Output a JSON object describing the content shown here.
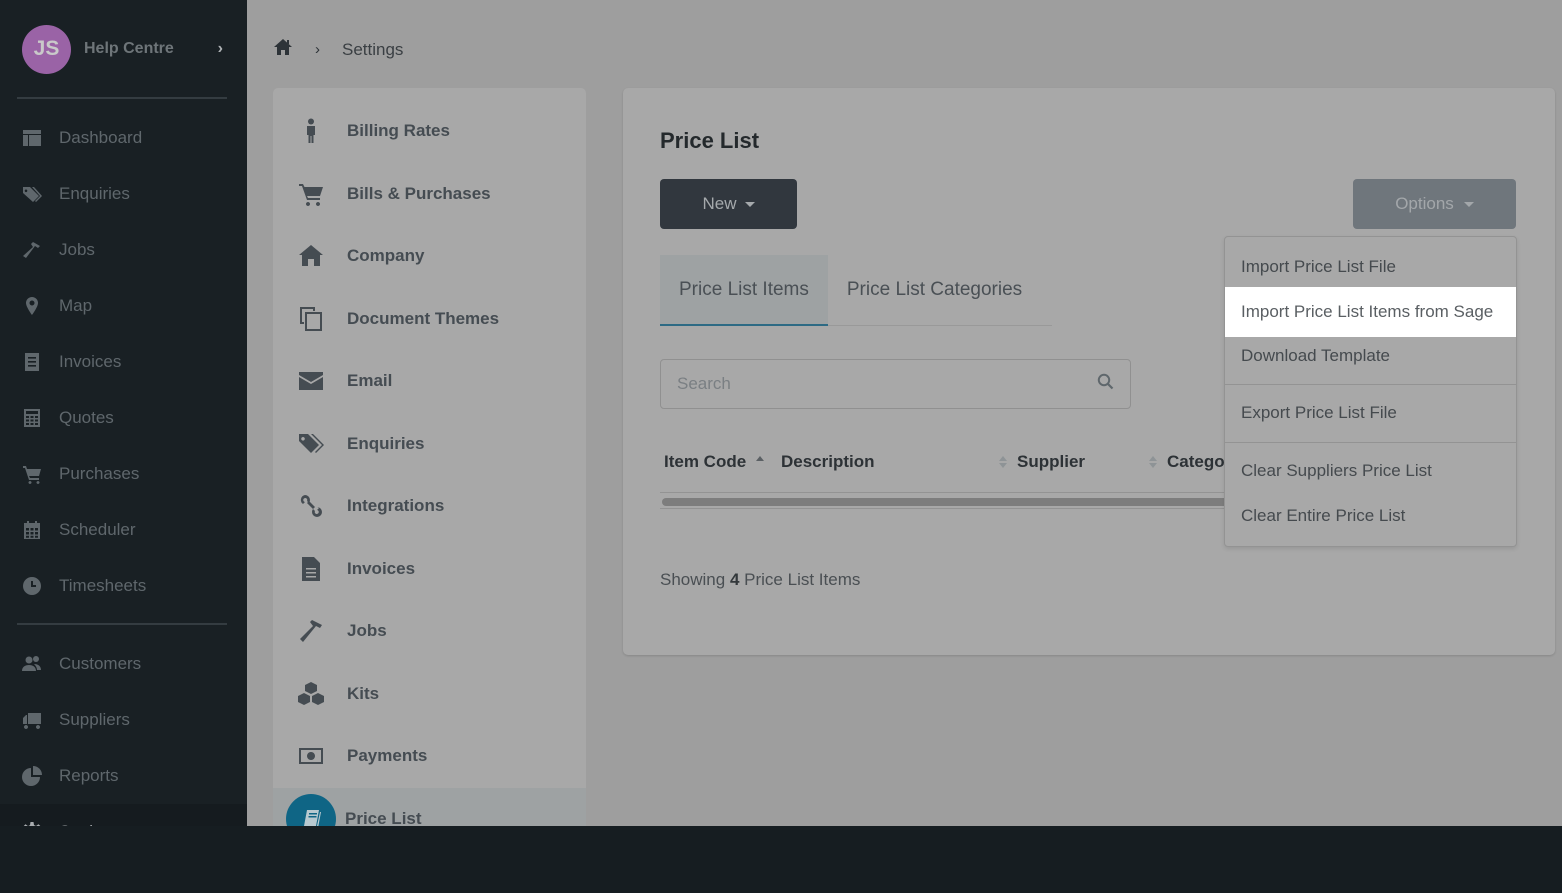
{
  "sidebar": {
    "avatar_initials": "JS",
    "title": "Help Centre",
    "items": [
      {
        "label": "Dashboard",
        "icon": "dashboard-icon"
      },
      {
        "label": "Enquiries",
        "icon": "tags-icon"
      },
      {
        "label": "Jobs",
        "icon": "hammer-icon"
      },
      {
        "label": "Map",
        "icon": "map-marker-icon"
      },
      {
        "label": "Invoices",
        "icon": "invoice-icon"
      },
      {
        "label": "Quotes",
        "icon": "calculator-icon"
      },
      {
        "label": "Purchases",
        "icon": "cart-icon"
      },
      {
        "label": "Scheduler",
        "icon": "calendar-icon"
      },
      {
        "label": "Timesheets",
        "icon": "clock-icon"
      },
      {
        "label": "Customers",
        "icon": "users-icon"
      },
      {
        "label": "Suppliers",
        "icon": "truck-icon"
      },
      {
        "label": "Reports",
        "icon": "pie-chart-icon"
      },
      {
        "label": "Settings",
        "icon": "gear-icon",
        "active": true
      }
    ]
  },
  "breadcrumb": {
    "home_icon": "home-icon",
    "current": "Settings"
  },
  "settings_nav": {
    "items": [
      {
        "label": "Billing Rates",
        "icon": "person-icon"
      },
      {
        "label": "Bills & Purchases",
        "icon": "cart-icon"
      },
      {
        "label": "Company",
        "icon": "home-icon"
      },
      {
        "label": "Document Themes",
        "icon": "copy-icon"
      },
      {
        "label": "Email",
        "icon": "envelope-icon"
      },
      {
        "label": "Enquiries",
        "icon": "tags-icon"
      },
      {
        "label": "Integrations",
        "icon": "link-icon"
      },
      {
        "label": "Invoices",
        "icon": "file-icon"
      },
      {
        "label": "Jobs",
        "icon": "hammer-icon"
      },
      {
        "label": "Kits",
        "icon": "cubes-icon"
      },
      {
        "label": "Payments",
        "icon": "money-icon"
      },
      {
        "label": "Price List",
        "icon": "book-icon",
        "active": true
      }
    ]
  },
  "main": {
    "title": "Price List",
    "new_button": "New",
    "options_button": "Options",
    "tabs": [
      {
        "label": "Price List Items",
        "active": true
      },
      {
        "label": "Price List Categories",
        "active": false
      }
    ],
    "search_placeholder": "Search",
    "table": {
      "columns": [
        {
          "label": "Item Code",
          "sort": "asc"
        },
        {
          "label": "Description",
          "sort": "none"
        },
        {
          "label": "Supplier",
          "sort": "none"
        },
        {
          "label": "Catego",
          "sort": "none"
        }
      ]
    },
    "showing_prefix": "Showing",
    "showing_count": "4",
    "showing_suffix": "Price List Items"
  },
  "options_menu": {
    "items": [
      {
        "label": "Import Price List File"
      },
      {
        "label": "Import Price List Items from Sage",
        "highlighted": true
      },
      {
        "label": "Download Template"
      },
      {
        "label": "Export Price List File"
      },
      {
        "label": "Clear Suppliers Price List"
      },
      {
        "label": "Clear Entire Price List"
      }
    ]
  }
}
